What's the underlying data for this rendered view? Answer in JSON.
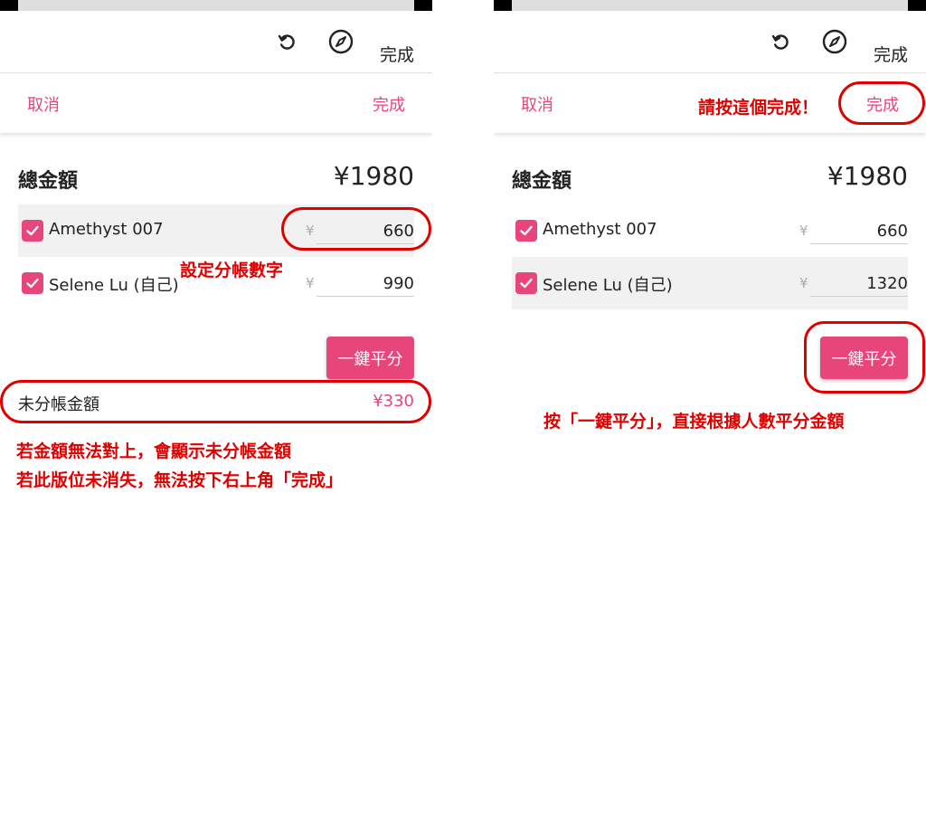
{
  "colors": {
    "accent": "#e8457b",
    "annotation": "#e00000"
  },
  "screens": [
    {
      "topbar": {
        "icons": [
          "refresh-icon",
          "compass-icon"
        ],
        "done_label": "完成"
      },
      "action_bar": {
        "cancel_label": "取消",
        "confirm_label": "完成"
      },
      "total": {
        "label": "總金額",
        "value": "¥1980"
      },
      "participants": [
        {
          "name": "Amethyst 007",
          "checked": true,
          "currency": "¥",
          "amount": "660"
        },
        {
          "name": "Selene Lu (自己)",
          "checked": true,
          "currency": "¥",
          "amount": "990"
        }
      ],
      "split_button_label": "一鍵平分",
      "unsplit": {
        "label": "未分帳金額",
        "value": "¥330"
      },
      "annotations": {
        "set_split": "設定分帳數字",
        "warning_line1": "若金額無法對上，會顯示未分帳金額",
        "warning_line2": "若此版位未消失，無法按下右上角「完成」"
      }
    },
    {
      "topbar": {
        "icons": [
          "refresh-icon",
          "compass-icon"
        ],
        "done_label": "完成"
      },
      "action_bar": {
        "cancel_label": "取消",
        "confirm_label": "完成"
      },
      "total": {
        "label": "總金額",
        "value": "¥1980"
      },
      "participants": [
        {
          "name": "Amethyst 007",
          "checked": true,
          "currency": "¥",
          "amount": "660"
        },
        {
          "name": "Selene Lu (自己)",
          "checked": true,
          "currency": "¥",
          "amount": "1320"
        }
      ],
      "split_button_label": "一鍵平分",
      "annotations": {
        "press_done": "請按這個完成！",
        "split_hint": "按「一鍵平分」，直接根據人數平分金額"
      }
    }
  ]
}
